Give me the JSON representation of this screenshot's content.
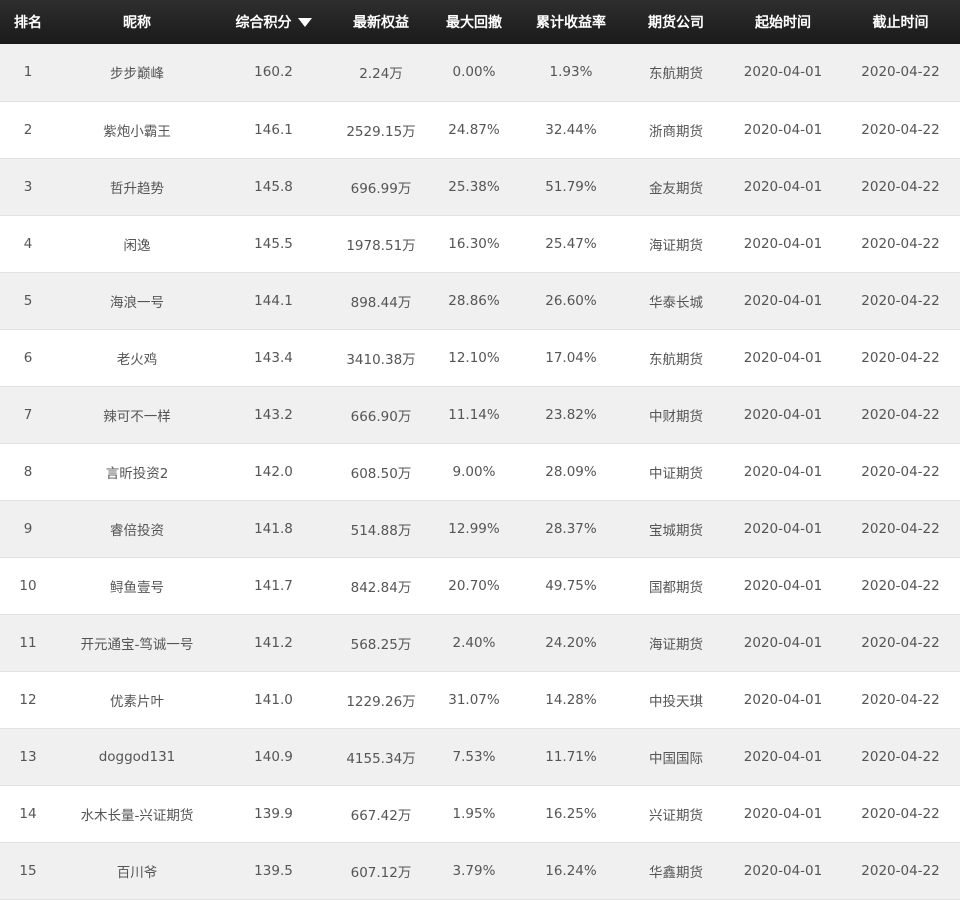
{
  "columns": {
    "rank": "排名",
    "nickname": "昵称",
    "score": "综合积分",
    "equity": "最新权益",
    "drawdown": "最大回撤",
    "return": "累计收益率",
    "broker": "期货公司",
    "start": "起始时间",
    "end": "截止时间"
  },
  "rows": [
    {
      "rank": "1",
      "nickname": "步步巅峰",
      "score": "160.2",
      "equity": "2.24万",
      "drawdown": "0.00%",
      "return": "1.93%",
      "broker": "东航期货",
      "start": "2020-04-01",
      "end": "2020-04-22"
    },
    {
      "rank": "2",
      "nickname": "紫炮小霸王",
      "score": "146.1",
      "equity": "2529.15万",
      "drawdown": "24.87%",
      "return": "32.44%",
      "broker": "浙商期货",
      "start": "2020-04-01",
      "end": "2020-04-22"
    },
    {
      "rank": "3",
      "nickname": "哲升趋势",
      "score": "145.8",
      "equity": "696.99万",
      "drawdown": "25.38%",
      "return": "51.79%",
      "broker": "金友期货",
      "start": "2020-04-01",
      "end": "2020-04-22"
    },
    {
      "rank": "4",
      "nickname": "闲逸",
      "score": "145.5",
      "equity": "1978.51万",
      "drawdown": "16.30%",
      "return": "25.47%",
      "broker": "海证期货",
      "start": "2020-04-01",
      "end": "2020-04-22"
    },
    {
      "rank": "5",
      "nickname": "海浪一号",
      "score": "144.1",
      "equity": "898.44万",
      "drawdown": "28.86%",
      "return": "26.60%",
      "broker": "华泰长城",
      "start": "2020-04-01",
      "end": "2020-04-22"
    },
    {
      "rank": "6",
      "nickname": "老火鸡",
      "score": "143.4",
      "equity": "3410.38万",
      "drawdown": "12.10%",
      "return": "17.04%",
      "broker": "东航期货",
      "start": "2020-04-01",
      "end": "2020-04-22"
    },
    {
      "rank": "7",
      "nickname": "辣可不一样",
      "score": "143.2",
      "equity": "666.90万",
      "drawdown": "11.14%",
      "return": "23.82%",
      "broker": "中财期货",
      "start": "2020-04-01",
      "end": "2020-04-22"
    },
    {
      "rank": "8",
      "nickname": "言昕投资2",
      "score": "142.0",
      "equity": "608.50万",
      "drawdown": "9.00%",
      "return": "28.09%",
      "broker": "中证期货",
      "start": "2020-04-01",
      "end": "2020-04-22"
    },
    {
      "rank": "9",
      "nickname": "睿倍投资",
      "score": "141.8",
      "equity": "514.88万",
      "drawdown": "12.99%",
      "return": "28.37%",
      "broker": "宝城期货",
      "start": "2020-04-01",
      "end": "2020-04-22"
    },
    {
      "rank": "10",
      "nickname": "鲟鱼壹号",
      "score": "141.7",
      "equity": "842.84万",
      "drawdown": "20.70%",
      "return": "49.75%",
      "broker": "国都期货",
      "start": "2020-04-01",
      "end": "2020-04-22"
    },
    {
      "rank": "11",
      "nickname": "开元通宝-笃诚一号",
      "score": "141.2",
      "equity": "568.25万",
      "drawdown": "2.40%",
      "return": "24.20%",
      "broker": "海证期货",
      "start": "2020-04-01",
      "end": "2020-04-22"
    },
    {
      "rank": "12",
      "nickname": "优素片叶",
      "score": "141.0",
      "equity": "1229.26万",
      "drawdown": "31.07%",
      "return": "14.28%",
      "broker": "中投天琪",
      "start": "2020-04-01",
      "end": "2020-04-22"
    },
    {
      "rank": "13",
      "nickname": "doggod131",
      "score": "140.9",
      "equity": "4155.34万",
      "drawdown": "7.53%",
      "return": "11.71%",
      "broker": "中国国际",
      "start": "2020-04-01",
      "end": "2020-04-22"
    },
    {
      "rank": "14",
      "nickname": "水木长量-兴证期货",
      "score": "139.9",
      "equity": "667.42万",
      "drawdown": "1.95%",
      "return": "16.25%",
      "broker": "兴证期货",
      "start": "2020-04-01",
      "end": "2020-04-22"
    },
    {
      "rank": "15",
      "nickname": "百川爷",
      "score": "139.5",
      "equity": "607.12万",
      "drawdown": "3.79%",
      "return": "16.24%",
      "broker": "华鑫期货",
      "start": "2020-04-01",
      "end": "2020-04-22"
    }
  ],
  "icons": {
    "sort": "sort-descending-icon"
  },
  "colors": {
    "header_bg": "#1f1f1f",
    "header_text": "#ffffff",
    "row_alt": "#f0f0f0",
    "cell_text": "#555555"
  }
}
